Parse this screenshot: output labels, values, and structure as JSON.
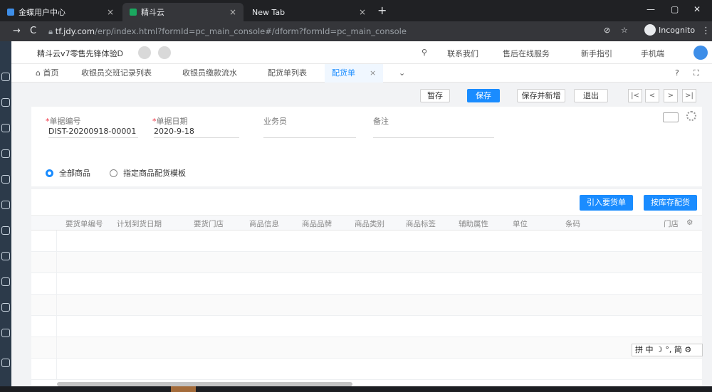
{
  "browser": {
    "tabs": [
      {
        "title": "金蝶用户中心",
        "active": false
      },
      {
        "title": "精斗云",
        "active": true
      },
      {
        "title": "New Tab",
        "active": false
      }
    ],
    "url_host": "tf.jdy.com",
    "url_path": "/erp/index.html?formId=pc_main_console#/dform?formId=pc_main_console",
    "incognito_label": "Incognito"
  },
  "header": {
    "account": "精斗云v7零售先锋体验D",
    "links": [
      "联系我们",
      "售后在线服务",
      "新手指引",
      "手机端"
    ]
  },
  "pagetabs": [
    {
      "label": "首页"
    },
    {
      "label": "收银员交班记录列表"
    },
    {
      "label": "收银员缴款流水"
    },
    {
      "label": "配货单列表"
    },
    {
      "label": "配货单",
      "active": true
    }
  ],
  "toolbar": {
    "temp_save": "暂存",
    "save": "保存",
    "save_new": "保存并新增",
    "exit": "退出"
  },
  "form": {
    "doc_no_label": "单据编号",
    "doc_no_value": "DIST-20200918-00001",
    "date_label": "单据日期",
    "date_value": "2020-9-18",
    "staff_label": "业务员",
    "remark_label": "备注",
    "radio_all": "全部商品",
    "radio_template": "指定商品配货模板"
  },
  "grid": {
    "btn_import": "引入要货单",
    "btn_stock": "按库存配货",
    "columns": [
      "要货单编号",
      "计划到货日期",
      "要货门店",
      "商品信息",
      "商品品牌",
      "商品类别",
      "商品标签",
      "辅助属性",
      "单位",
      "条码",
      "门店"
    ]
  },
  "ime": "拼 中 ☽ °, 简 ⚙"
}
